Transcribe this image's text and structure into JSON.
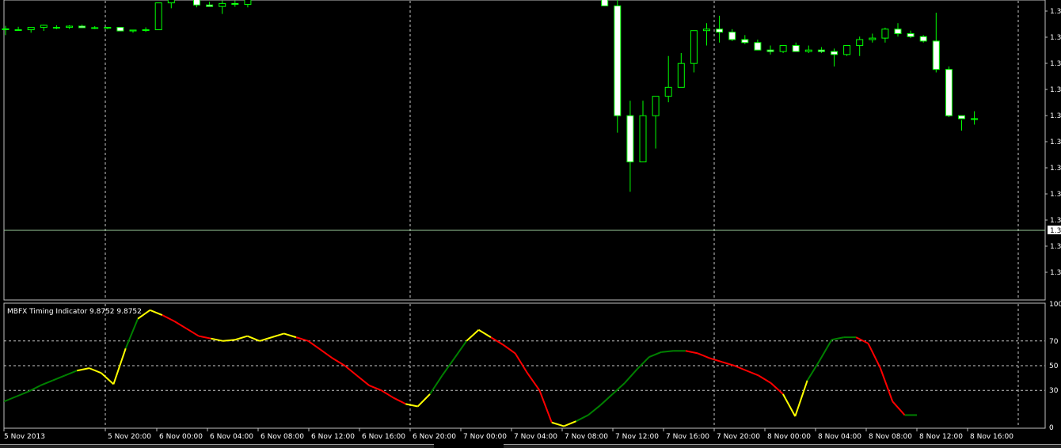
{
  "price_axis": {
    "labels": [
      "1.3",
      "1.3",
      "1.3",
      "1.3",
      "1.3",
      "1.3",
      "1.3",
      "1.3",
      "1.3",
      "1.3",
      "1.3"
    ],
    "current_price_label": "1.3"
  },
  "indicator": {
    "title": "MBFX Timing Indicator 9.8752 9.8752",
    "axis_labels": [
      "100",
      "70",
      "50",
      "30",
      "0"
    ]
  },
  "time_axis": {
    "labels": [
      "5 Nov 2013",
      "5 Nov 20:00",
      "6 Nov 00:00",
      "6 Nov 04:00",
      "6 Nov 08:00",
      "6 Nov 12:00",
      "6 Nov 16:00",
      "6 Nov 20:00",
      "7 Nov 00:00",
      "7 Nov 04:00",
      "7 Nov 08:00",
      "7 Nov 12:00",
      "7 Nov 16:00",
      "7 Nov 20:00",
      "8 Nov 00:00",
      "8 Nov 04:00",
      "8 Nov 08:00",
      "8 Nov 12:00",
      "8 Nov 16:00"
    ]
  },
  "colors": {
    "background": "#000000",
    "bull_candle": "#000000",
    "bear_candle": "#ffffff",
    "wick": "#00ff00",
    "grid": "#c8c8c8",
    "indicator_up": "#008000",
    "indicator_down": "#ff0000",
    "indicator_turn": "#ffff00"
  },
  "chart_data": [
    {
      "type": "candlestick",
      "title": "",
      "ylabel": "",
      "ylim": [
        0,
        100
      ],
      "candles": [
        [
          90.5,
          91.6,
          88.5,
          90.6
        ],
        [
          90.1,
          91.3,
          90.1,
          90.3
        ],
        [
          90.3,
          91.1,
          89.3,
          91.1
        ],
        [
          91.1,
          92.0,
          89.9,
          91.8
        ],
        [
          91.1,
          91.8,
          90.5,
          90.9
        ],
        [
          91.1,
          91.8,
          90.6,
          91.5
        ],
        [
          91.5,
          92.0,
          90.9,
          91.0
        ],
        [
          91.0,
          91.5,
          90.5,
          90.9
        ],
        [
          90.8,
          91.1,
          90.5,
          91.1
        ],
        [
          91.1,
          91.1,
          89.9,
          89.9
        ],
        [
          89.9,
          90.2,
          89.3,
          90.2
        ],
        [
          90.2,
          91.1,
          89.6,
          90.3
        ],
        [
          90.3,
          99.3,
          90.3,
          99.3
        ],
        [
          99.3,
          102.0,
          97.5,
          101.1
        ],
        [
          101.1,
          101.8,
          100.3,
          100.4
        ],
        [
          100.4,
          100.8,
          97.8,
          98.6
        ],
        [
          98.6,
          99.7,
          98.4,
          98.1
        ],
        [
          98.1,
          100.1,
          95.6,
          99.1
        ],
        [
          99.1,
          100.1,
          98.0,
          98.8
        ],
        [
          98.8,
          102.9,
          97.8,
          101.9
        ],
        [
          101.9,
          103.9,
          101.2,
          101.2
        ],
        [
          101.2,
          103.8,
          100.8,
          101.4
        ],
        [
          101.4,
          104.3,
          101.1,
          101.8
        ],
        [
          101.8,
          107.3,
          101.5,
          106.9
        ],
        [
          106.9,
          108.0,
          102.5,
          102.5
        ],
        [
          102.5,
          117.4,
          102.3,
          113.2
        ],
        [
          113.2,
          114.1,
          107.8,
          108.7
        ],
        [
          108.7,
          109.7,
          106.7,
          108.1
        ],
        [
          108.1,
          109.3,
          106.6,
          107.4
        ],
        [
          107.4,
          109.7,
          104.8,
          106.2
        ],
        [
          106.2,
          107.0,
          105.1,
          106.6
        ],
        [
          106.6,
          107.3,
          106.1,
          106.9
        ],
        [
          106.9,
          108.0,
          103.9,
          104.4
        ],
        [
          104.4,
          105.3,
          104.3,
          104.9
        ],
        [
          104.9,
          105.0,
          104.1,
          104.2
        ],
        [
          104.2,
          105.7,
          104.2,
          105.6
        ],
        [
          105.6,
          105.6,
          102.2,
          101.7
        ],
        [
          101.7,
          103.3,
          100.9,
          102.9
        ],
        [
          102.9,
          104.0,
          102.6,
          103.7
        ],
        [
          103.7,
          104.3,
          103.5,
          104.1
        ],
        [
          104.1,
          104.3,
          103.2,
          104.6
        ],
        [
          104.6,
          105.4,
          104.2,
          107.6
        ],
        [
          107.6,
          108.0,
          107.2,
          107.8
        ],
        [
          107.8,
          108.0,
          105.7,
          105.4
        ],
        [
          105.4,
          106.6,
          104.9,
          105.2
        ],
        [
          105.2,
          106.4,
          104.7,
          106.6
        ],
        [
          106.6,
          106.6,
          103.0,
          103.2
        ],
        [
          103.2,
          103.7,
          99.5,
          98.3
        ],
        [
          98.3,
          100.9,
          55.8,
          61.5
        ],
        [
          61.5,
          66.5,
          36.0,
          46.0
        ],
        [
          46.0,
          66.5,
          47.0,
          61.5
        ],
        [
          61.5,
          68.0,
          50.5,
          68.0
        ],
        [
          68.0,
          81.5,
          66.0,
          71.0
        ],
        [
          71.0,
          82.5,
          71.0,
          79.0
        ],
        [
          79.0,
          85.5,
          76.0,
          90.0
        ],
        [
          90.0,
          92.5,
          85.0,
          90.5
        ],
        [
          90.5,
          95.0,
          86.0,
          89.5
        ],
        [
          89.5,
          90.5,
          86.5,
          87.0
        ],
        [
          87.0,
          88.5,
          85.5,
          86.0
        ],
        [
          86.0,
          87.0,
          83.5,
          83.5
        ],
        [
          83.5,
          85.0,
          82.0,
          83.0
        ],
        [
          83.0,
          85.0,
          82.5,
          85.0
        ],
        [
          85.0,
          86.0,
          83.0,
          83.0
        ],
        [
          83.0,
          85.0,
          82.5,
          83.5
        ],
        [
          83.5,
          84.5,
          82.5,
          83.0
        ],
        [
          83.0,
          84.0,
          78.0,
          82.0
        ],
        [
          82.0,
          84.0,
          81.5,
          85.0
        ],
        [
          85.0,
          88.0,
          81.5,
          87.0
        ],
        [
          87.0,
          89.0,
          86.0,
          87.5
        ],
        [
          87.5,
          91.0,
          86.0,
          90.5
        ],
        [
          90.5,
          92.5,
          88.0,
          89.0
        ],
        [
          89.0,
          90.0,
          87.5,
          88.0
        ],
        [
          88.0,
          88.5,
          86.0,
          86.5
        ],
        [
          86.5,
          96.0,
          76.0,
          77.0
        ],
        [
          77.0,
          78.0,
          61.0,
          61.5
        ],
        [
          61.5,
          60.0,
          56.5,
          60.5
        ],
        [
          60.5,
          63.0,
          58.5,
          60.5
        ]
      ]
    },
    {
      "type": "line",
      "title": "MBFX Timing Indicator",
      "ylim": [
        0,
        100
      ],
      "series": [
        {
          "values": [
            21,
            25,
            29,
            34,
            38,
            42,
            46,
            48,
            44,
            35,
            64,
            88,
            95,
            91,
            86,
            80,
            74,
            72,
            70,
            71,
            74,
            70,
            73,
            76,
            73,
            70,
            63,
            56,
            50,
            42,
            34,
            30,
            24,
            19,
            17,
            27,
            42,
            56,
            70,
            79,
            73,
            67,
            60,
            44,
            30,
            4,
            1,
            5,
            10,
            18,
            27,
            36,
            47,
            57,
            61,
            62,
            62,
            60,
            56,
            53,
            50,
            46,
            42,
            36,
            27,
            9,
            38,
            54,
            71,
            73,
            73,
            68,
            48,
            21,
            10,
            10
          ]
        }
      ]
    }
  ]
}
